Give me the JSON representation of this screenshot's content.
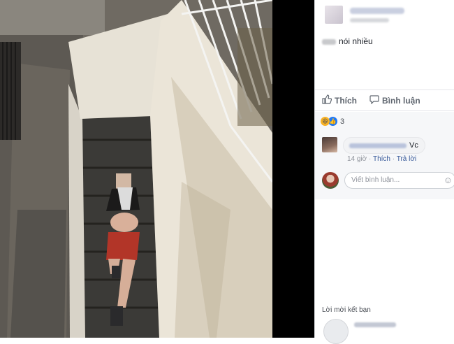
{
  "post": {
    "caption": "nói nhiều"
  },
  "actions": {
    "like_label": "Thích",
    "comment_label": "Bình luận"
  },
  "reactions": {
    "count": "3"
  },
  "comment": {
    "text": "Vc",
    "time": "14 giờ",
    "like_link": "Thích",
    "reply_link": "Trả lời"
  },
  "composer": {
    "placeholder": "Viết bình luận..."
  },
  "sidebar": {
    "friend_requests_title": "Lời mời kết bạn"
  },
  "colors": {
    "link": "#365899",
    "like_blue": "#2078f4",
    "haha_yellow": "#f7b125",
    "panel_bg": "#f6f7f9"
  }
}
